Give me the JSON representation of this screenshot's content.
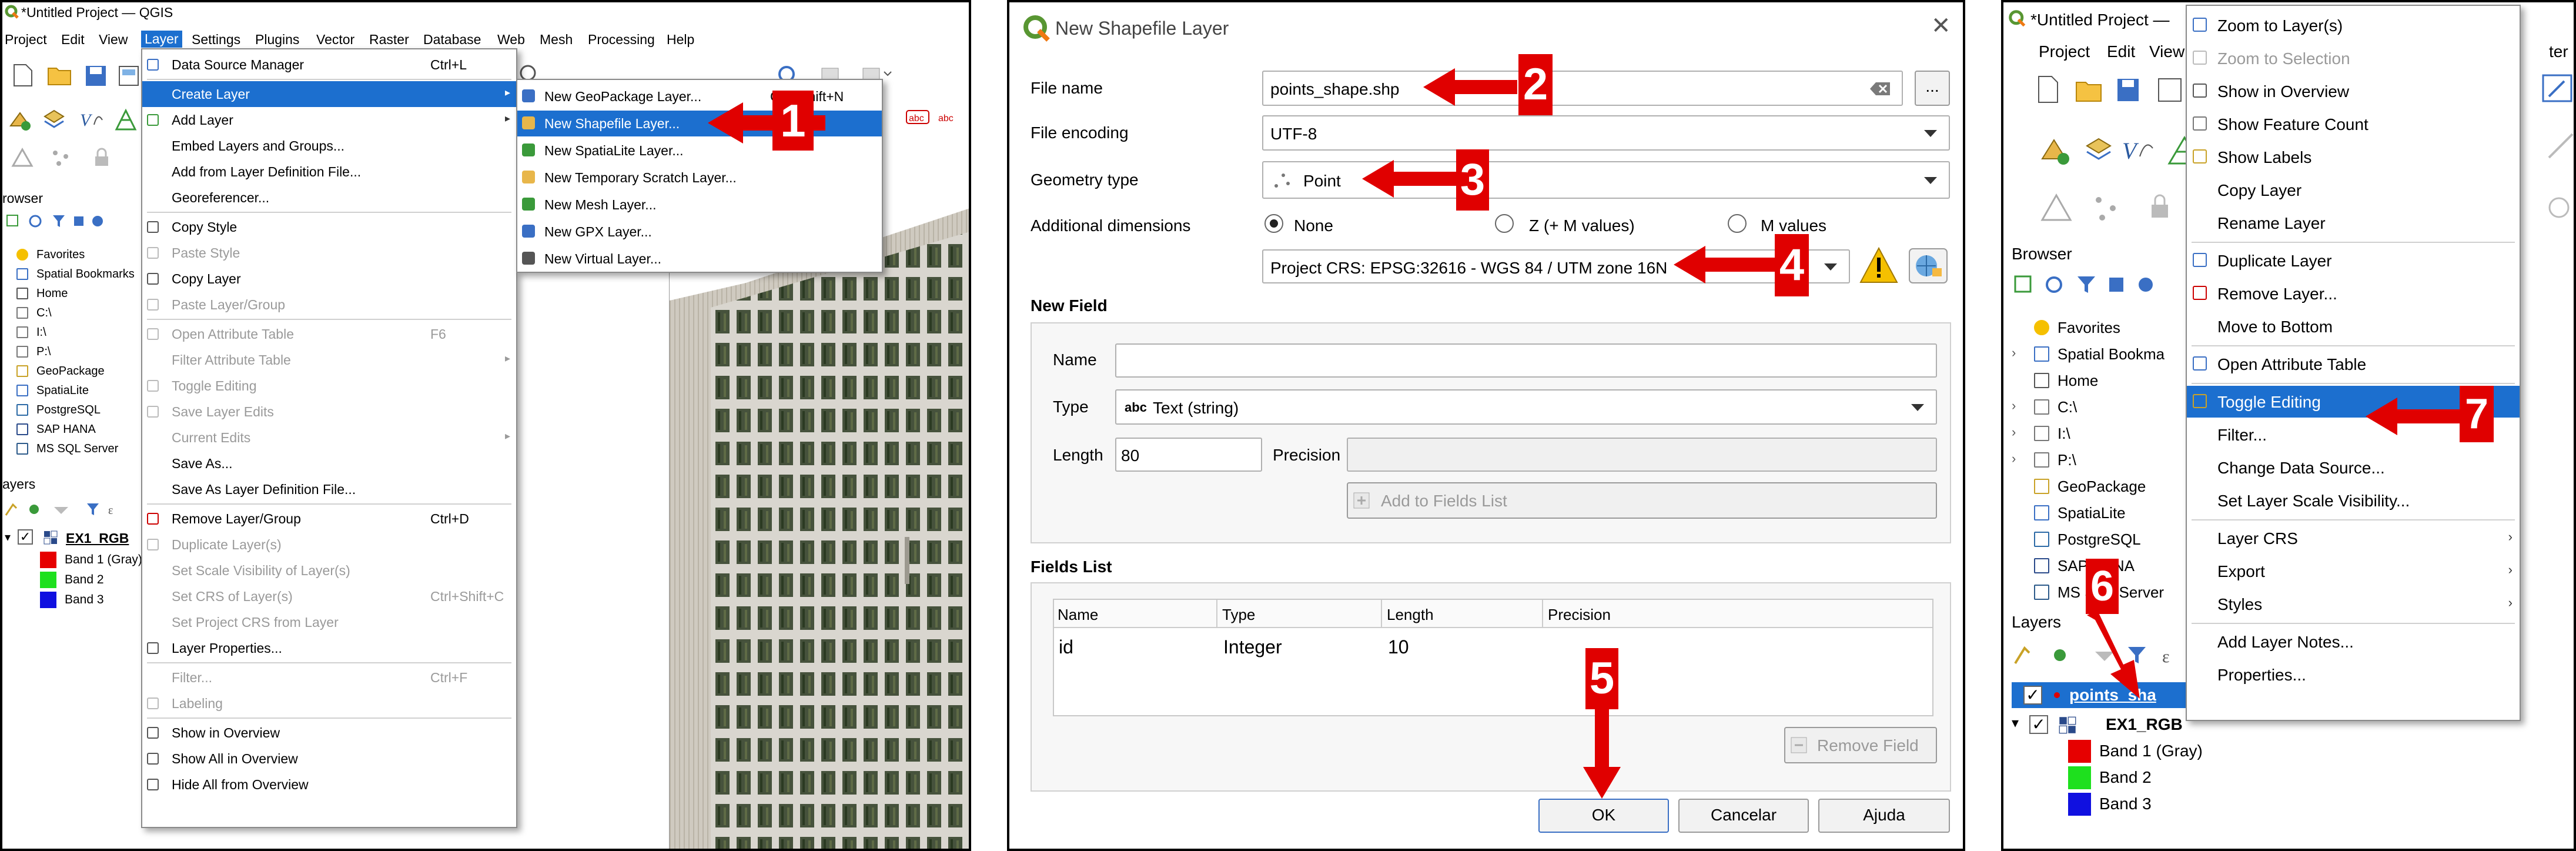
{
  "qgis_left": {
    "title": "*Untitled Project — QGIS",
    "menubar": [
      "Project",
      "Edit",
      "View",
      "Layer",
      "Settings",
      "Plugins",
      "Vector",
      "Raster",
      "Database",
      "Web",
      "Mesh",
      "Processing",
      "Help"
    ],
    "layer_menu": [
      {
        "label": "Data Source Manager",
        "shortcut": "Ctrl+L"
      },
      {
        "label": "Create Layer",
        "submenu": true
      },
      {
        "label": "Add Layer",
        "submenu": true
      },
      {
        "label": "Embed Layers and Groups..."
      },
      {
        "label": "Add from Layer Definition File..."
      },
      {
        "label": "Georeferencer..."
      },
      {
        "label": "Copy Style"
      },
      {
        "label": "Paste Style"
      },
      {
        "label": "Copy Layer"
      },
      {
        "label": "Paste Layer/Group"
      },
      {
        "label": "Open Attribute Table",
        "shortcut": "F6"
      },
      {
        "label": "Filter Attribute Table",
        "submenu": true
      },
      {
        "label": "Toggle Editing"
      },
      {
        "label": "Save Layer Edits"
      },
      {
        "label": "Current Edits",
        "submenu": true
      },
      {
        "label": "Save As..."
      },
      {
        "label": "Save As Layer Definition File..."
      },
      {
        "label": "Remove Layer/Group",
        "shortcut": "Ctrl+D"
      },
      {
        "label": "Duplicate Layer(s)"
      },
      {
        "label": "Set Scale Visibility of Layer(s)"
      },
      {
        "label": "Set CRS of Layer(s)",
        "shortcut": "Ctrl+Shift+C"
      },
      {
        "label": "Set Project CRS from Layer"
      },
      {
        "label": "Layer Properties..."
      },
      {
        "label": "Filter...",
        "shortcut": "Ctrl+F"
      },
      {
        "label": "Labeling"
      },
      {
        "label": "Show in Overview"
      },
      {
        "label": "Show All in Overview"
      },
      {
        "label": "Hide All from Overview"
      }
    ],
    "create_submenu": [
      {
        "label": "New GeoPackage Layer...",
        "shortcut": "Ctrl+Shift+N"
      },
      {
        "label": "New Shapefile Layer..."
      },
      {
        "label": "New SpatiaLite Layer..."
      },
      {
        "label": "New Temporary Scratch Layer..."
      },
      {
        "label": "New Mesh Layer..."
      },
      {
        "label": "New GPX Layer..."
      },
      {
        "label": "New Virtual Layer..."
      }
    ],
    "browser_title": "rowser",
    "browser_items": [
      "Favorites",
      "Spatial Bookmarks",
      "Home",
      "C:\\",
      "I:\\",
      "P:\\",
      "GeoPackage",
      "SpatiaLite",
      "PostgreSQL",
      "SAP HANA",
      "MS SQL Server"
    ],
    "layers_title": "ayers",
    "layer_name": "EX1_RGB",
    "bands": [
      "Band 1 (Gray)",
      "Band 2",
      "Band 3"
    ],
    "step_labels": [
      "1"
    ]
  },
  "dialog": {
    "title": "New Shapefile Layer",
    "file_name_label": "File name",
    "file_name_value": "points_shape.shp",
    "browse_label": "...",
    "encoding_label": "File encoding",
    "encoding_value": "UTF-8",
    "geometry_label": "Geometry type",
    "geometry_value": "Point",
    "dimensions_label": "Additional dimensions",
    "dim_none": "None",
    "dim_zm": "Z (+ M values)",
    "dim_m": "M values",
    "crs_value": "Project CRS: EPSG:32616 - WGS 84 / UTM zone 16N",
    "new_field_title": "New Field",
    "name_label": "Name",
    "type_label": "Type",
    "type_value": "Text (string)",
    "type_abbr": "abc",
    "length_label": "Length",
    "length_value": "80",
    "precision_label": "Precision",
    "add_field_button": "Add to Fields List",
    "fields_list_title": "Fields List",
    "columns": [
      "Name",
      "Type",
      "Length",
      "Precision"
    ],
    "rows": [
      [
        "id",
        "Integer",
        "10",
        ""
      ]
    ],
    "remove_field_button": "Remove Field",
    "ok": "OK",
    "cancel": "Cancelar",
    "help": "Ajuda",
    "step_labels": [
      "2",
      "3",
      "4",
      "5"
    ]
  },
  "qgis_right": {
    "title": "*Untitled Project —",
    "menubar": [
      "Project",
      "Edit",
      "View"
    ],
    "menubar_tail": "ter",
    "context_menu": [
      {
        "label": "Zoom to Layer(s)"
      },
      {
        "label": "Zoom to Selection",
        "disabled": true
      },
      {
        "label": "Show in Overview"
      },
      {
        "label": "Show Feature Count"
      },
      {
        "label": "Show Labels"
      },
      {
        "label": "Copy Layer"
      },
      {
        "label": "Rename Layer"
      },
      {
        "label": "Duplicate Layer"
      },
      {
        "label": "Remove Layer..."
      },
      {
        "label": "Move to Bottom"
      },
      {
        "label": "Open Attribute Table"
      },
      {
        "label": "Toggle Editing"
      },
      {
        "label": "Filter..."
      },
      {
        "label": "Change Data Source..."
      },
      {
        "label": "Set Layer Scale Visibility..."
      },
      {
        "label": "Layer CRS"
      },
      {
        "label": "Export"
      },
      {
        "label": "Styles"
      },
      {
        "label": "Add Layer Notes..."
      },
      {
        "label": "Properties..."
      }
    ],
    "browser_title": "Browser",
    "browser_items": [
      "Favorites",
      "Spatial Bookma",
      "Home",
      "C:\\",
      "I:\\",
      "P:\\",
      "GeoPackage",
      "SpatiaLite",
      "PostgreSQL",
      "SAP HANA",
      "MS SQL Server"
    ],
    "layers_title": "Layers",
    "layer_points": "points_sha",
    "layer_raster": "EX1_RGB",
    "bands": [
      "Band 1 (Gray)",
      "Band 2",
      "Band 3"
    ],
    "step_labels": [
      "6",
      "7"
    ]
  },
  "colors": {
    "highlight": "#1c6fcf",
    "arrow": "#e00000",
    "band1": "#e60000",
    "band2": "#1ee01e",
    "band3": "#1010e0"
  }
}
